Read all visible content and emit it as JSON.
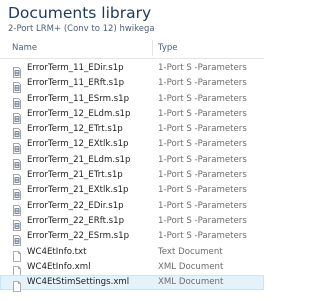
{
  "library": {
    "title": "Documents library",
    "subtitle": "2-Port LRM+ (Conv to 12) hwikega"
  },
  "columns": {
    "name": "Name",
    "type": "Type"
  },
  "colors": {
    "title": "#1e395b",
    "selected_row": "#e5f1fb"
  },
  "files": [
    {
      "name": "ErrorTerm_11_EDir.s1p",
      "type": "1-Port S -Parameters",
      "icon": "s-parameter-file-icon",
      "selected": false
    },
    {
      "name": "ErrorTerm_11_ERft.s1p",
      "type": "1-Port S -Parameters",
      "icon": "s-parameter-file-icon",
      "selected": false
    },
    {
      "name": "ErrorTerm_11_ESrm.s1p",
      "type": "1-Port S -Parameters",
      "icon": "s-parameter-file-icon",
      "selected": false
    },
    {
      "name": "ErrorTerm_12_ELdm.s1p",
      "type": "1-Port S -Parameters",
      "icon": "s-parameter-file-icon",
      "selected": false
    },
    {
      "name": "ErrorTerm_12_ETrt.s1p",
      "type": "1-Port S -Parameters",
      "icon": "s-parameter-file-icon",
      "selected": false
    },
    {
      "name": "ErrorTerm_12_EXtlk.s1p",
      "type": "1-Port S -Parameters",
      "icon": "s-parameter-file-icon",
      "selected": false
    },
    {
      "name": "ErrorTerm_21_ELdm.s1p",
      "type": "1-Port S -Parameters",
      "icon": "s-parameter-file-icon",
      "selected": false
    },
    {
      "name": "ErrorTerm_21_ETrt.s1p",
      "type": "1-Port S -Parameters",
      "icon": "s-parameter-file-icon",
      "selected": false
    },
    {
      "name": "ErrorTerm_21_EXtlk.s1p",
      "type": "1-Port S -Parameters",
      "icon": "s-parameter-file-icon",
      "selected": false
    },
    {
      "name": "ErrorTerm_22_EDir.s1p",
      "type": "1-Port S -Parameters",
      "icon": "s-parameter-file-icon",
      "selected": false
    },
    {
      "name": "ErrorTerm_22_ERft.s1p",
      "type": "1-Port S -Parameters",
      "icon": "s-parameter-file-icon",
      "selected": false
    },
    {
      "name": "ErrorTerm_22_ESrm.s1p",
      "type": "1-Port S -Parameters",
      "icon": "s-parameter-file-icon",
      "selected": false
    },
    {
      "name": "WC4EtInfo.txt",
      "type": "Text Document",
      "icon": "text-file-icon",
      "selected": false
    },
    {
      "name": "WC4EtInfo.xml",
      "type": "XML Document",
      "icon": "xml-file-icon",
      "selected": false
    },
    {
      "name": "WC4EtStimSettings.xml",
      "type": "XML Document",
      "icon": "xml-file-icon",
      "selected": true
    }
  ]
}
